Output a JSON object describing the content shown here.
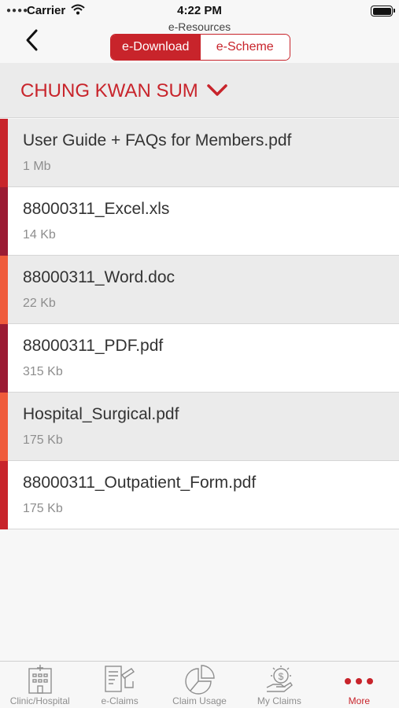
{
  "status_bar": {
    "carrier": "Carrier",
    "time": "4:22 PM"
  },
  "nav": {
    "title": "e-Resources",
    "segments": [
      {
        "label": "e-Download",
        "selected": true
      },
      {
        "label": "e-Scheme",
        "selected": false
      }
    ]
  },
  "member": {
    "name": "CHUNG KWAN SUM"
  },
  "files": [
    {
      "name": "User Guide + FAQs for Members.pdf",
      "size": "1 Mb",
      "accent": "#c8242b",
      "bg": "#ebebeb"
    },
    {
      "name": "88000311_Excel.xls",
      "size": "14 Kb",
      "accent": "#9b1b33",
      "bg": "#ffffff"
    },
    {
      "name": "88000311_Word.doc",
      "size": "22 Kb",
      "accent": "#ef5b3b",
      "bg": "#ebebeb"
    },
    {
      "name": "88000311_PDF.pdf",
      "size": "315 Kb",
      "accent": "#9b1b33",
      "bg": "#ffffff"
    },
    {
      "name": "Hospital_Surgical.pdf",
      "size": "175 Kb",
      "accent": "#ef5b3b",
      "bg": "#ebebeb"
    },
    {
      "name": "88000311_Outpatient_Form.pdf",
      "size": "175 Kb",
      "accent": "#c8242b",
      "bg": "#ffffff"
    }
  ],
  "tabs": [
    {
      "label": "Clinic/Hospital",
      "icon": "hospital-icon",
      "active": false
    },
    {
      "label": "e-Claims",
      "icon": "claim-form-icon",
      "active": false
    },
    {
      "label": "Claim Usage",
      "icon": "pie-chart-icon",
      "active": false
    },
    {
      "label": "My Claims",
      "icon": "money-hand-icon",
      "active": false
    },
    {
      "label": "More",
      "icon": "more-dots-icon",
      "active": true
    }
  ],
  "colors": {
    "accent": "#c8242b",
    "inactive_tab": "#8e8e8e"
  }
}
